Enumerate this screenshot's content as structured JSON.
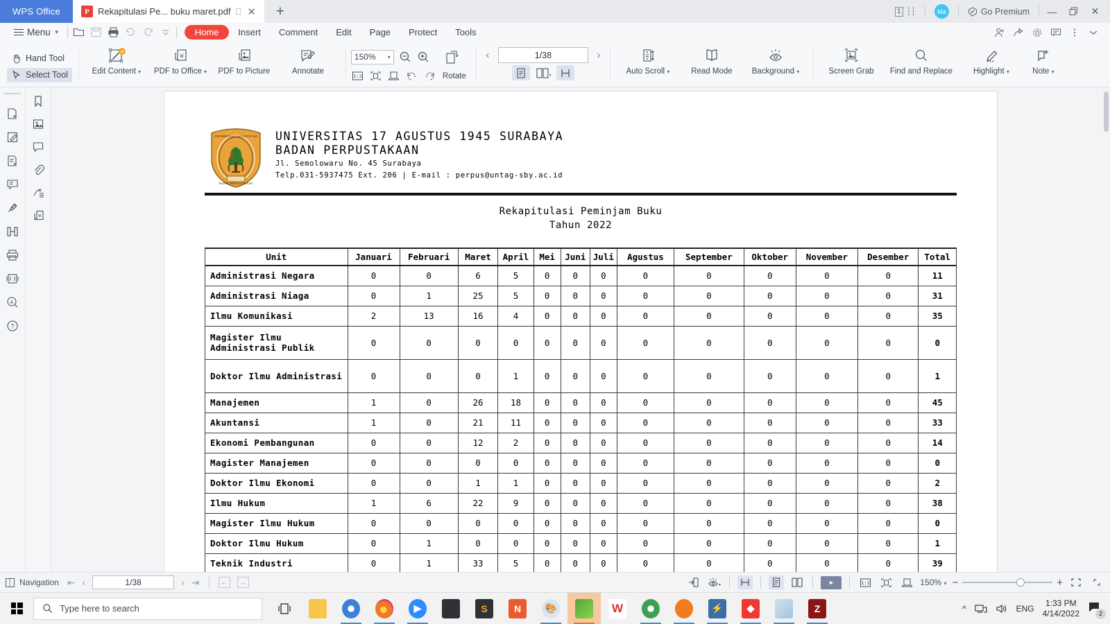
{
  "titlebar": {
    "app_name": "WPS Office",
    "tab_title": "Rekapitulasi Pe... buku maret.pdf",
    "tab_icon_letter": "P",
    "new_tab_label": "+",
    "page_count_indicator": "1",
    "avatar_initials": "Ma",
    "premium_label": "Go Premium",
    "minimize": "—",
    "restore": "❐",
    "close": "✕"
  },
  "menubar": {
    "menu_label": "Menu",
    "tabs": [
      {
        "label": "Home",
        "active": true
      },
      {
        "label": "Insert",
        "active": false
      },
      {
        "label": "Comment",
        "active": false
      },
      {
        "label": "Edit",
        "active": false
      },
      {
        "label": "Page",
        "active": false
      },
      {
        "label": "Protect",
        "active": false
      },
      {
        "label": "Tools",
        "active": false
      }
    ]
  },
  "ribbon": {
    "hand_tool": "Hand Tool",
    "select_tool": "Select Tool",
    "edit_content": "Edit Content",
    "pdf_to_office": "PDF to Office",
    "pdf_to_picture": "PDF to Picture",
    "annotate": "Annotate",
    "zoom_value": "150%",
    "rotate": "Rotate",
    "page_number": "1/38",
    "auto_scroll": "Auto Scroll",
    "read_mode": "Read Mode",
    "background": "Background",
    "screen_grab": "Screen Grab",
    "find_and_replace": "Find and Replace",
    "highlight": "Highlight",
    "note": "Note"
  },
  "document": {
    "org_line1": "UNIVERSITAS 17 AGUSTUS 1945 SURABAYA",
    "org_line2": "BADAN PERPUSTAKAAN",
    "address": "Jl. Semolowaru No. 45 Surabaya",
    "contact": "Telp.031-5937475 Ext. 206 | E-mail : perpus@untag-sby.ac.id",
    "title_line1": "Rekapitulasi Peminjam Buku",
    "title_line2": "Tahun 2022",
    "table": {
      "headers": [
        "Unit",
        "Januari",
        "Februari",
        "Maret",
        "April",
        "Mei",
        "Juni",
        "Juli",
        "Agustus",
        "September",
        "Oktober",
        "November",
        "Desember",
        "Total"
      ],
      "rows": [
        {
          "unit": "Administrasi Negara",
          "values": [
            0,
            0,
            6,
            5,
            0,
            0,
            0,
            0,
            0,
            0,
            0,
            0
          ],
          "total": 11,
          "tall": false
        },
        {
          "unit": "Administrasi Niaga",
          "values": [
            0,
            1,
            25,
            5,
            0,
            0,
            0,
            0,
            0,
            0,
            0,
            0
          ],
          "total": 31,
          "tall": false
        },
        {
          "unit": "Ilmu Komunikasi",
          "values": [
            2,
            13,
            16,
            4,
            0,
            0,
            0,
            0,
            0,
            0,
            0,
            0
          ],
          "total": 35,
          "tall": false
        },
        {
          "unit": "Magister Ilmu Administrasi Publik",
          "values": [
            0,
            0,
            0,
            0,
            0,
            0,
            0,
            0,
            0,
            0,
            0,
            0
          ],
          "total": 0,
          "tall": true
        },
        {
          "unit": "Doktor Ilmu Administrasi",
          "values": [
            0,
            0,
            0,
            1,
            0,
            0,
            0,
            0,
            0,
            0,
            0,
            0
          ],
          "total": 1,
          "tall": true
        },
        {
          "unit": "Manajemen",
          "values": [
            1,
            0,
            26,
            18,
            0,
            0,
            0,
            0,
            0,
            0,
            0,
            0
          ],
          "total": 45,
          "tall": false
        },
        {
          "unit": "Akuntansi",
          "values": [
            1,
            0,
            21,
            11,
            0,
            0,
            0,
            0,
            0,
            0,
            0,
            0
          ],
          "total": 33,
          "tall": false
        },
        {
          "unit": "Ekonomi Pembangunan",
          "values": [
            0,
            0,
            12,
            2,
            0,
            0,
            0,
            0,
            0,
            0,
            0,
            0
          ],
          "total": 14,
          "tall": false
        },
        {
          "unit": "Magister Manajemen",
          "values": [
            0,
            0,
            0,
            0,
            0,
            0,
            0,
            0,
            0,
            0,
            0,
            0
          ],
          "total": 0,
          "tall": false
        },
        {
          "unit": "Doktor Ilmu Ekonomi",
          "values": [
            0,
            0,
            1,
            1,
            0,
            0,
            0,
            0,
            0,
            0,
            0,
            0
          ],
          "total": 2,
          "tall": false
        },
        {
          "unit": "Ilmu Hukum",
          "values": [
            1,
            6,
            22,
            9,
            0,
            0,
            0,
            0,
            0,
            0,
            0,
            0
          ],
          "total": 38,
          "tall": false
        },
        {
          "unit": "Magister Ilmu Hukum",
          "values": [
            0,
            0,
            0,
            0,
            0,
            0,
            0,
            0,
            0,
            0,
            0,
            0
          ],
          "total": 0,
          "tall": false
        },
        {
          "unit": "Doktor Ilmu Hukum",
          "values": [
            0,
            1,
            0,
            0,
            0,
            0,
            0,
            0,
            0,
            0,
            0,
            0
          ],
          "total": 1,
          "tall": false
        },
        {
          "unit": "Teknik Industri",
          "values": [
            0,
            1,
            33,
            5,
            0,
            0,
            0,
            0,
            0,
            0,
            0,
            0
          ],
          "total": 39,
          "tall": false
        }
      ]
    }
  },
  "statusbar": {
    "navigation_label": "Navigation",
    "page_number": "1/38",
    "zoom_value": "150%"
  },
  "taskbar": {
    "search_placeholder": "Type here to search",
    "language": "ENG",
    "time": "1:33 PM",
    "date": "4/14/2022",
    "notification_count": "2"
  },
  "colors": {
    "accent_red": "#f3453c",
    "wps_blue": "#4a7ddb",
    "logo_gold": "#e8a33d",
    "selection_blue": "#dde3ee"
  }
}
